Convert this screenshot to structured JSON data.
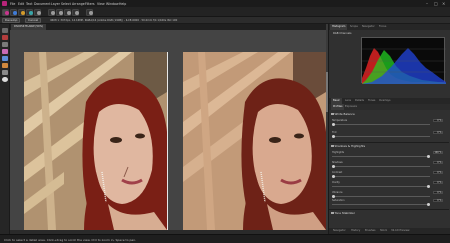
{
  "menu": {
    "items": [
      "File",
      "Edit",
      "Text",
      "Document",
      "Layer",
      "Select",
      "Arrange",
      "Filters",
      "View",
      "Window",
      "Help"
    ],
    "logo_icon": "affinity-photo-logo",
    "window_controls": [
      "minimize-icon",
      "maximize-icon",
      "close-icon"
    ]
  },
  "persona_buttons": [
    "photo-persona-icon",
    "liquify-persona-icon",
    "develop-persona-icon",
    "tone-mapping-persona-icon",
    "export-persona-icon"
  ],
  "context": {
    "develop_label": "Develop",
    "cancel_label": "Cancel",
    "info_text": "4608 × 3072px, 14.16MP, RGBA/16 (Adobe RGB (1998)) - ILCE-6000 · 50.0mm f/4 1/160s ISO 100"
  },
  "document": {
    "tab_title": "DSC05478.ARW (50%)"
  },
  "panel": {
    "top_tabs": [
      "Histogram",
      "Scope",
      "Navigator",
      "Focus"
    ],
    "histogram_label": "RGB Channels",
    "mid_tabs": [
      "Basic",
      "Lens",
      "Details",
      "Tones",
      "Overlays"
    ],
    "sub_tabs": [
      "Profiles",
      "Exposure"
    ],
    "section_white_balance": "White Balance",
    "label_temperature": "Temperature",
    "val_temperature": "0 %",
    "label_tint": "Tint",
    "val_tint": "0 %",
    "section_shadows": "Shadows & Highlights",
    "label_highlights": "Highlights",
    "val_highlights": "100 %",
    "label_shadows": "Shadows",
    "val_shadows": "0 %",
    "label_contrast": "Contrast",
    "val_contrast": "0 %",
    "label_clarity": "Clarity",
    "val_clarity": "0 %",
    "label_vibrance": "Vibrance",
    "val_vibrance": "0 %",
    "label_saturation": "Saturation",
    "val_saturation": "0 %",
    "section_profiles": "Tone Stabilizer",
    "bottom_tabs": [
      "Navigator",
      "History",
      "Brushes",
      "Stock",
      "32-bit Preview"
    ]
  },
  "status": {
    "text": "Click to select a detail area. Click+drag to scroll the view. Ctrl to zoom in, Space to pan."
  },
  "colors": {
    "accent": "#c8358d",
    "panel_bg": "#303030",
    "canvas_bg": "#444444"
  }
}
